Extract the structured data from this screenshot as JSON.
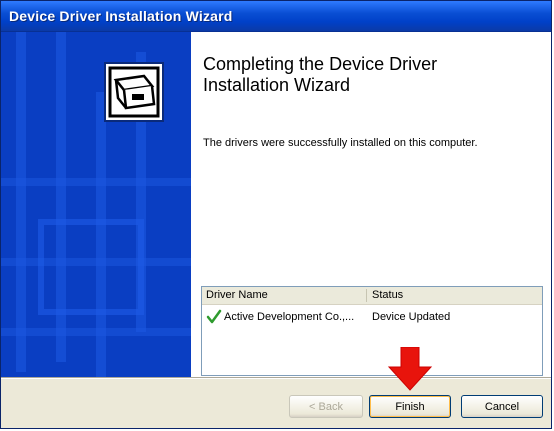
{
  "window": {
    "title": "Device Driver Installation Wizard"
  },
  "side_panel": {
    "logo_icon": "device-box-icon"
  },
  "content": {
    "heading_line1": "Completing the Device Driver",
    "heading_line2": "Installation Wizard",
    "message": "The drivers were successfully installed on this computer."
  },
  "driver_list": {
    "columns": [
      "Driver Name",
      "Status"
    ],
    "rows": [
      {
        "name": "Active Development Co.,...",
        "status": "Device Updated",
        "icon": "green-check-icon"
      }
    ]
  },
  "buttons": {
    "back": "< Back",
    "finish": "Finish",
    "cancel": "Cancel"
  },
  "colors": {
    "title_bar": "#0a4fd4",
    "side_panel": "#0a3ec2",
    "highlight_arrow": "#e8140c"
  }
}
